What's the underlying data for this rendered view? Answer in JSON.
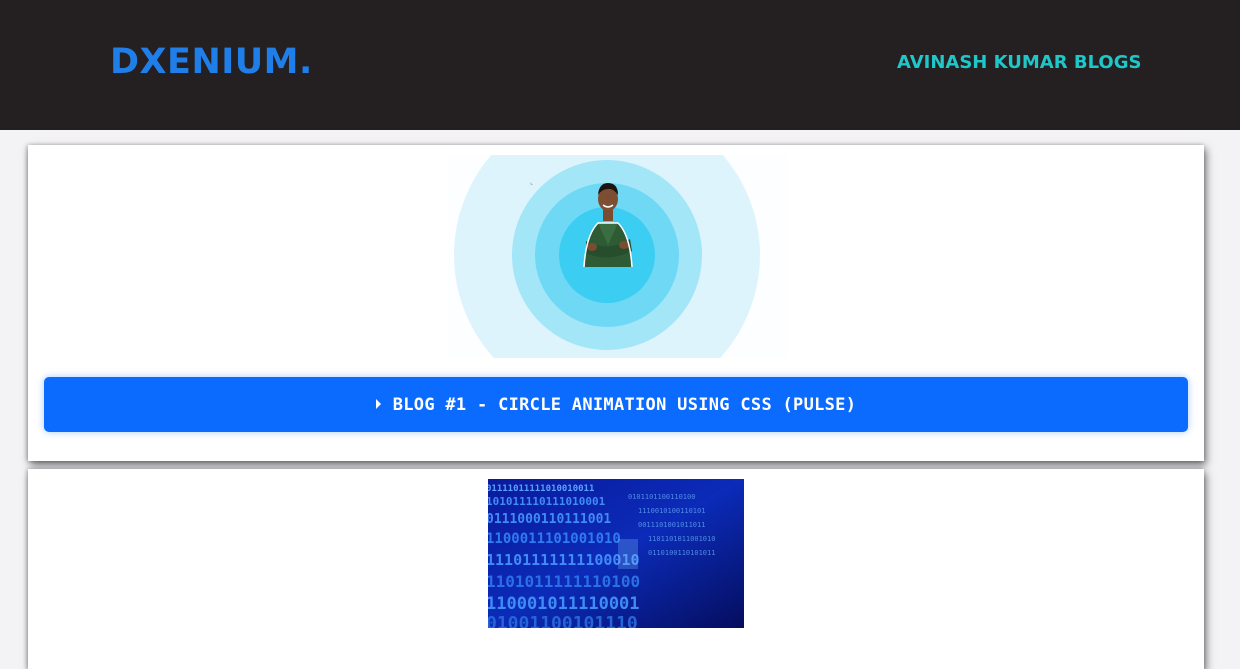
{
  "header": {
    "logo": "DXENIUM.",
    "nav_link": "AVINASH KUMAR BLOGS"
  },
  "posts": [
    {
      "title": "BLOG #1 - CIRCLE ANIMATION USING CSS (PULSE)",
      "thumbnail": "person-pulse-circles-image",
      "icon": "caret-right-icon"
    },
    {
      "thumbnail": "binary-code-image"
    }
  ],
  "colors": {
    "header_bg": "#241f21",
    "logo": "#1f7ee8",
    "nav_link": "#1fc7c9",
    "button": "#0b6bff",
    "page_bg": "#f3f2f5"
  }
}
